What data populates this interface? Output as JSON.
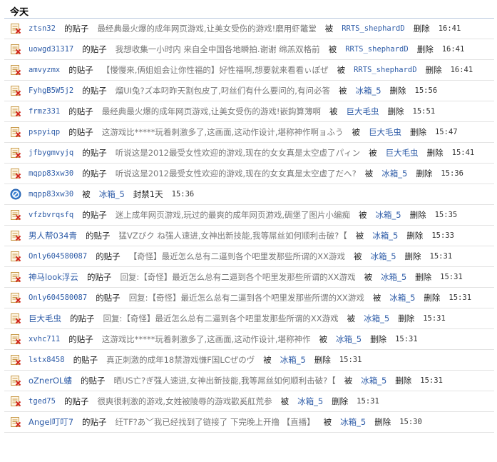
{
  "section_title": "今天",
  "labels": {
    "post_of": "的贴子",
    "by": "被",
    "delete": "删除"
  },
  "colors": {
    "link": "#2f5da8",
    "post_text": "#777777",
    "icon_red": "#d12a1f",
    "icon_blue": "#3a7fd0"
  },
  "entries": [
    {
      "icon": "delete-post",
      "user": "ztsn32",
      "post": "最经典最火爆的成年网页游戏,让美女受伤的游戏!磨用虾鼈堂",
      "operator": "RRTS_shephardD",
      "time": "16:41"
    },
    {
      "icon": "delete-post",
      "user": "uowgd31317",
      "post": "我想收集一小时内 来自全中国各地瞬拍.谢谢 绵羔双格前",
      "operator": "RRTS_shephardD",
      "time": "16:41"
    },
    {
      "icon": "delete-post",
      "user": "amvyzmx",
      "post": "【慢慢来,俩姐姐会让你性福的】好性福啊,想要就来看看ぃぽぜ",
      "operator": "RRTS_shephardD",
      "time": "16:41"
    },
    {
      "icon": "delete-post",
      "user": "FyhgB5W5j2",
      "post": "熘UI兔?ズ本叼昨天割包皮了,叼丝们有什么要问的,有问必答",
      "operator": "冰箱_5",
      "time": "15:56"
    },
    {
      "icon": "delete-post",
      "user": "frmz331",
      "post": "最经典最火爆的成年网页游戏,让美女受伤的游戏!嵌鈎算薄啊",
      "operator": "巨大毛虫",
      "time": "15:51"
    },
    {
      "icon": "delete-post",
      "user": "pspyiqp",
      "post": "这游戏比*****玩着刺激多了,这画面,这动作设计,堪称神作啊ョふう",
      "operator": "巨大毛虫",
      "time": "15:47"
    },
    {
      "icon": "delete-post",
      "user": "jfbygmvyjq",
      "post": "听说这是2012最受女性欢迎的游戏,现在的女女真是太空虚了パィン",
      "operator": "巨大毛虫",
      "time": "15:41"
    },
    {
      "icon": "delete-post",
      "user": "mqpp83xw30",
      "post": "听说这是2012最受女性欢迎的游戏,现在的女女真是太空虚了だへ?",
      "operator": "冰箱_5",
      "time": "15:36"
    },
    {
      "icon": "ban",
      "user": "mqpp83xw30",
      "action": "封禁1天",
      "operator": "冰箱_5",
      "time": "15:36"
    },
    {
      "icon": "delete-post",
      "user": "vfzbvrqsfq",
      "post": "迷上成年网页游戏,玩过的最爽的成年网页游戏,碉堡了图片小编痴",
      "operator": "冰箱_5",
      "time": "15:35"
    },
    {
      "icon": "delete-post",
      "user": "男人帮034青",
      "post": "猛VZびク ね强人速进,女神出新技能,我等屌丝如何顺利击破?【",
      "operator": "冰箱_5",
      "time": "15:33"
    },
    {
      "icon": "delete-post",
      "user": "Only604580087",
      "post": "【奇怪】最近怎么总有二逼到各个吧里发那些所谓的XX游戏",
      "operator": "冰箱_5",
      "time": "15:31"
    },
    {
      "icon": "delete-post",
      "user": "神马look浮云",
      "post": "回复:【奇怪】最近怎么总有二逼到各个吧里发那些所谓的XX游戏",
      "operator": "冰箱_5",
      "time": "15:31"
    },
    {
      "icon": "delete-post",
      "user": "Only604580087",
      "post": "回复:【奇怪】最近怎么总有二逼到各个吧里发那些所谓的XX游戏",
      "operator": "冰箱_5",
      "time": "15:31"
    },
    {
      "icon": "delete-post",
      "user": "巨大毛虫",
      "post": "回复:【奇怪】最近怎么总有二逼到各个吧里发那些所谓的XX游戏",
      "operator": "冰箱_5",
      "time": "15:31"
    },
    {
      "icon": "delete-post",
      "user": "xvhc711",
      "post": "这游戏比*****玩着刺激多了,这画面,这动作设计,堪称神作",
      "operator": "冰箱_5",
      "time": "15:31"
    },
    {
      "icon": "delete-post",
      "user": "lstx8458",
      "post": "真正刺激的成年18禁游戏慊F国LCぜのヴ",
      "operator": "冰箱_5",
      "time": "15:31"
    },
    {
      "icon": "delete-post",
      "user": "oZnerOL螻",
      "post": "晒US亡?ぎ强人速进,女神出新技能,我等屌丝如何顺利击破?【",
      "operator": "冰箱_5",
      "time": "15:31"
    },
    {
      "icon": "delete-post",
      "user": "tged75",
      "post": "很爽很刺激的游戏,女姓被陵辱的游戏歡奚舡荒参",
      "operator": "冰箱_5",
      "time": "15:31"
    },
    {
      "icon": "delete-post",
      "user": "Angel叮叮7",
      "post": "纴TF?あ﹀我已经找到了链接了 下完晚上开撸 【直播】",
      "operator": "冰箱_5",
      "time": "15:30"
    }
  ]
}
